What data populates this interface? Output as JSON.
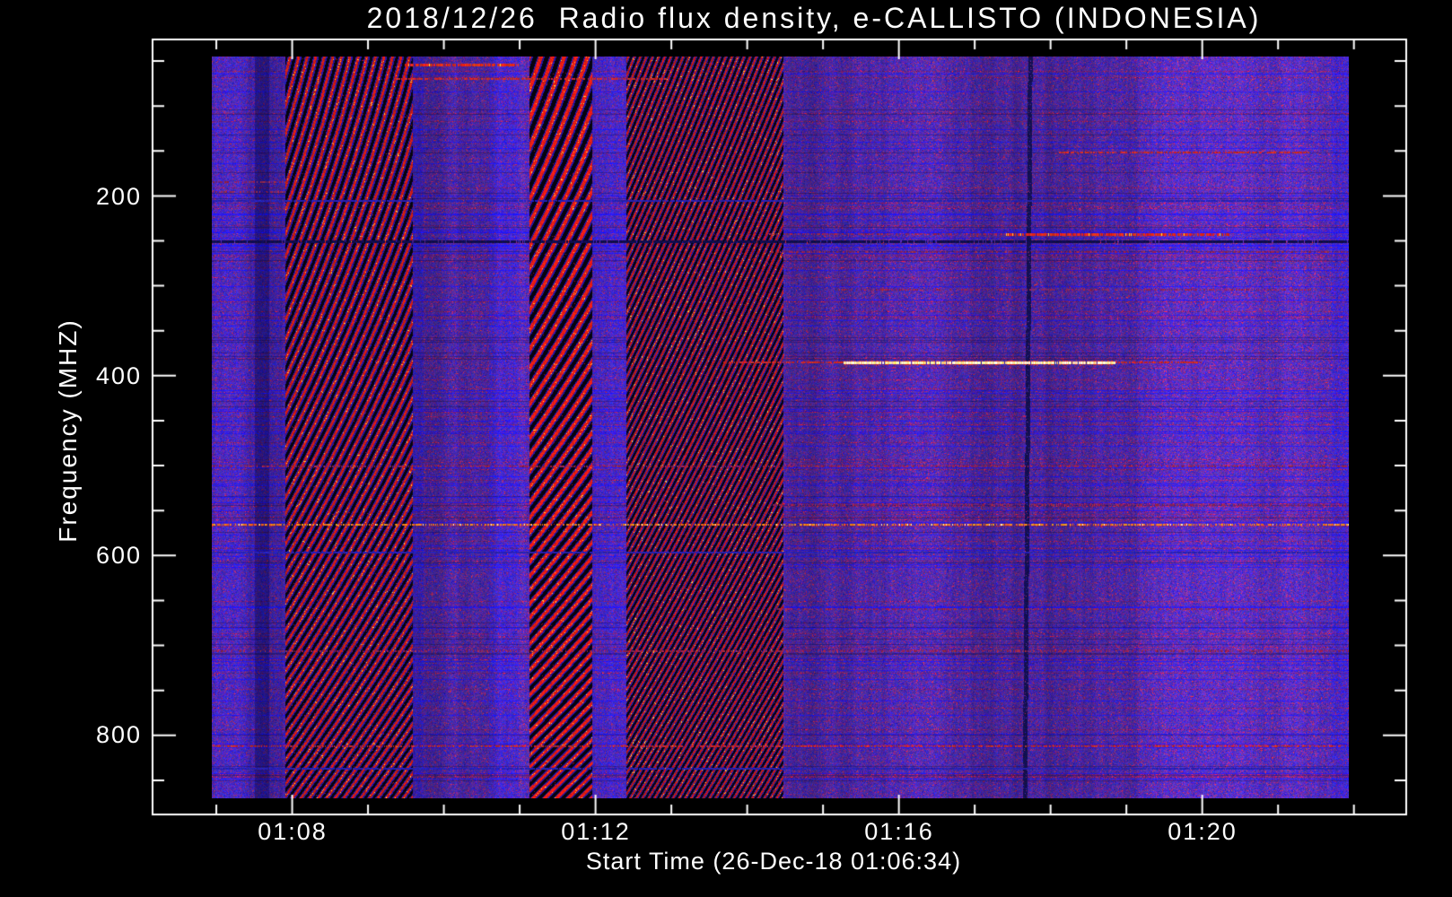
{
  "title": "2018/12/26  Radio flux density, e-CALLISTO (INDONESIA)",
  "chart_data": {
    "type": "heatmap",
    "subtype": "radio-spectrogram",
    "title": "2018/12/26  Radio flux density, e-CALLISTO (INDONESIA)",
    "xlabel": "Start Time (26-Dec-18 01:06:34)",
    "ylabel": "Frequency (MHZ)",
    "x_tick_labels": [
      "01:08",
      "01:12",
      "01:16",
      "01:20"
    ],
    "y_tick_labels": [
      "200",
      "400",
      "600",
      "800"
    ],
    "y_tick_values": [
      200,
      400,
      600,
      800
    ],
    "y_minor_step_mhz": 50,
    "freq_range_mhz": [
      45,
      870
    ],
    "freq_increases_downward": true,
    "time_start": "01:06:34",
    "date": "26-Dec-18",
    "duration_minutes": 15,
    "x_tick_series": {
      "start_frac": 0.004,
      "step_frac": 0.0667,
      "count": 16,
      "major_offset": 1,
      "major_every": 4
    },
    "colors": {
      "background": "#000000",
      "axes": "#ffffff",
      "noise_purple": "#4a32a8",
      "noise_blue": "#2a28d0",
      "noise_violet_red": "#7a2a96",
      "rfi_red": "#e02010",
      "rfi_orange": "#ff9020",
      "rfi_yellow_white": "#fff0a0",
      "band_black": "#050308",
      "dark_line_navy": "#10104a"
    },
    "features": {
      "diagonal_bands": [
        {
          "x0_frac": 0.0647,
          "x1_frac": 0.177,
          "spacing": 9.5,
          "slope": 0.26,
          "curve": 0.00028,
          "red_w": 3.0,
          "blue_w": 1.8,
          "bright": 1.0
        },
        {
          "x0_frac": 0.2794,
          "x1_frac": 0.3346,
          "spacing": 13.0,
          "slope": 0.34,
          "curve": 0.00042,
          "red_w": 4.6,
          "blue_w": 2.0,
          "bright": 1.15
        },
        {
          "x0_frac": 0.3646,
          "x1_frac": 0.5028,
          "spacing": 6.8,
          "slope": 0.4,
          "curve": 0.00012,
          "red_w": 2.2,
          "blue_w": 1.2,
          "bright": 0.95
        }
      ],
      "tint_columns": [
        {
          "x0_frac": 0.0,
          "x1_frac": 0.0647,
          "tint": "blue",
          "strength": 0.22
        },
        {
          "x0_frac": 0.0379,
          "x1_frac": 0.0505,
          "tint": "darkblue",
          "strength": 0.5
        },
        {
          "x0_frac": 0.171,
          "x1_frac": 0.186,
          "tint": "blue",
          "strength": 0.45
        },
        {
          "x0_frac": 0.244,
          "x1_frac": 0.27,
          "tint": "blue",
          "strength": 0.35
        },
        {
          "x0_frac": 0.335,
          "x1_frac": 0.365,
          "tint": "blue",
          "strength": 0.3
        },
        {
          "x0_frac": 0.985,
          "x1_frac": 1.0,
          "tint": "blue",
          "strength": 0.4
        }
      ],
      "dark_vline": {
        "x_frac": 0.718,
        "width": 5,
        "tilt": -6
      },
      "h_lines": [
        {
          "freq": 54,
          "x0_frac": 0.17,
          "x1_frac": 0.27,
          "style": "red-bright"
        },
        {
          "freq": 70,
          "x0_frac": 0.16,
          "x1_frac": 0.4,
          "style": "red"
        },
        {
          "freq": 152,
          "x0_frac": 0.745,
          "x1_frac": 0.966,
          "style": "red"
        },
        {
          "freq": 185,
          "x0_frac": 0.0,
          "x1_frac": 0.065,
          "style": "red-dim"
        },
        {
          "freq": 196,
          "x0_frac": 0.0,
          "x1_frac": 0.065,
          "style": "red-dim"
        },
        {
          "freq": 243,
          "x0_frac": 0.698,
          "x1_frac": 0.895,
          "style": "red-bright"
        },
        {
          "freq": 243,
          "x0_frac": 0.49,
          "x1_frac": 0.698,
          "style": "red-dim"
        },
        {
          "freq": 262,
          "x0_frac": 0.49,
          "x1_frac": 1.0,
          "style": "red-dim"
        },
        {
          "freq": 304,
          "x0_frac": 0.55,
          "x1_frac": 1.0,
          "style": "red-dim"
        },
        {
          "freq": 385,
          "x0_frac": 0.45,
          "x1_frac": 0.556,
          "style": "red"
        },
        {
          "freq": 385,
          "x0_frac": 0.556,
          "x1_frac": 0.795,
          "style": "yellow-bright"
        },
        {
          "freq": 385,
          "x0_frac": 0.795,
          "x1_frac": 0.872,
          "style": "red"
        },
        {
          "freq": 501,
          "x0_frac": 0.0,
          "x1_frac": 1.0,
          "style": "red-dim"
        },
        {
          "freq": 544,
          "x0_frac": 0.49,
          "x1_frac": 1.0,
          "style": "red-dim"
        },
        {
          "freq": 566,
          "x0_frac": 0.0,
          "x1_frac": 1.0,
          "style": "orange-speckle"
        },
        {
          "freq": 660,
          "x0_frac": 0.49,
          "x1_frac": 1.0,
          "style": "red-dim"
        },
        {
          "freq": 706,
          "x0_frac": 0.0,
          "x1_frac": 1.0,
          "style": "red-dim"
        },
        {
          "freq": 812,
          "x0_frac": 0.0,
          "x1_frac": 1.0,
          "style": "red-speckle"
        }
      ],
      "blue_rows": [
        {
          "freq": 205,
          "dark": false
        },
        {
          "freq": 250,
          "dark": true
        },
        {
          "freq": 596,
          "dark": false
        },
        {
          "freq": 836,
          "dark": false
        }
      ]
    }
  }
}
